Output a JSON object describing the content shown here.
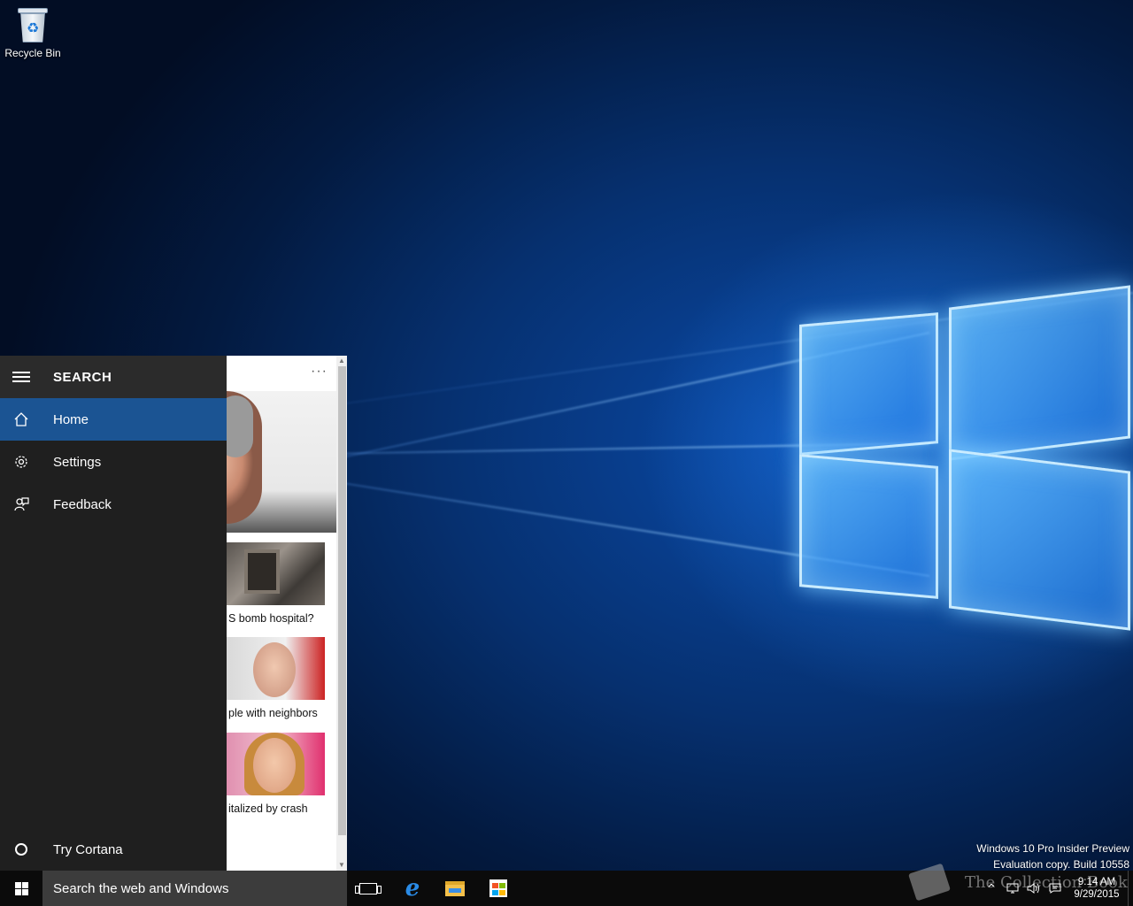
{
  "desktop": {
    "icons": [
      {
        "label": "Recycle Bin",
        "icon": "recycle-bin-icon"
      }
    ],
    "watermark": {
      "line1": "Windows 10 Pro Insider Preview",
      "line2": "Evaluation copy. Build 10558"
    }
  },
  "search_panel": {
    "title": "SEARCH",
    "nav_items": [
      {
        "label": "Home",
        "icon": "home-icon",
        "selected": true
      },
      {
        "label": "Settings",
        "icon": "gear-icon",
        "selected": false
      },
      {
        "label": "Feedback",
        "icon": "feedback-icon",
        "selected": false
      }
    ],
    "bottom_item": {
      "label": "Try Cortana",
      "icon": "cortana-circle-icon"
    },
    "more_label": "···",
    "news": [
      {
        "caption": "S bomb hospital?"
      },
      {
        "caption": "ple with neighbors"
      },
      {
        "caption": "italized by crash"
      }
    ]
  },
  "taskbar": {
    "search_placeholder": "Search the web and Windows",
    "pinned": [
      "task-view-icon",
      "edge-icon",
      "file-explorer-icon",
      "store-icon"
    ],
    "clock": {
      "time": "9:14 AM",
      "date": "9/29/2015"
    },
    "tray_icons": [
      "chevron-up-icon",
      "network-icon",
      "volume-icon",
      "action-center-icon"
    ],
    "overlay_watermark": "The Collection Book"
  },
  "colors": {
    "accent": "#1b5493",
    "nav_background": "#1f1f1f",
    "taskbar_background": "#0b0b0b",
    "search_box_background": "#3c3c3c"
  }
}
